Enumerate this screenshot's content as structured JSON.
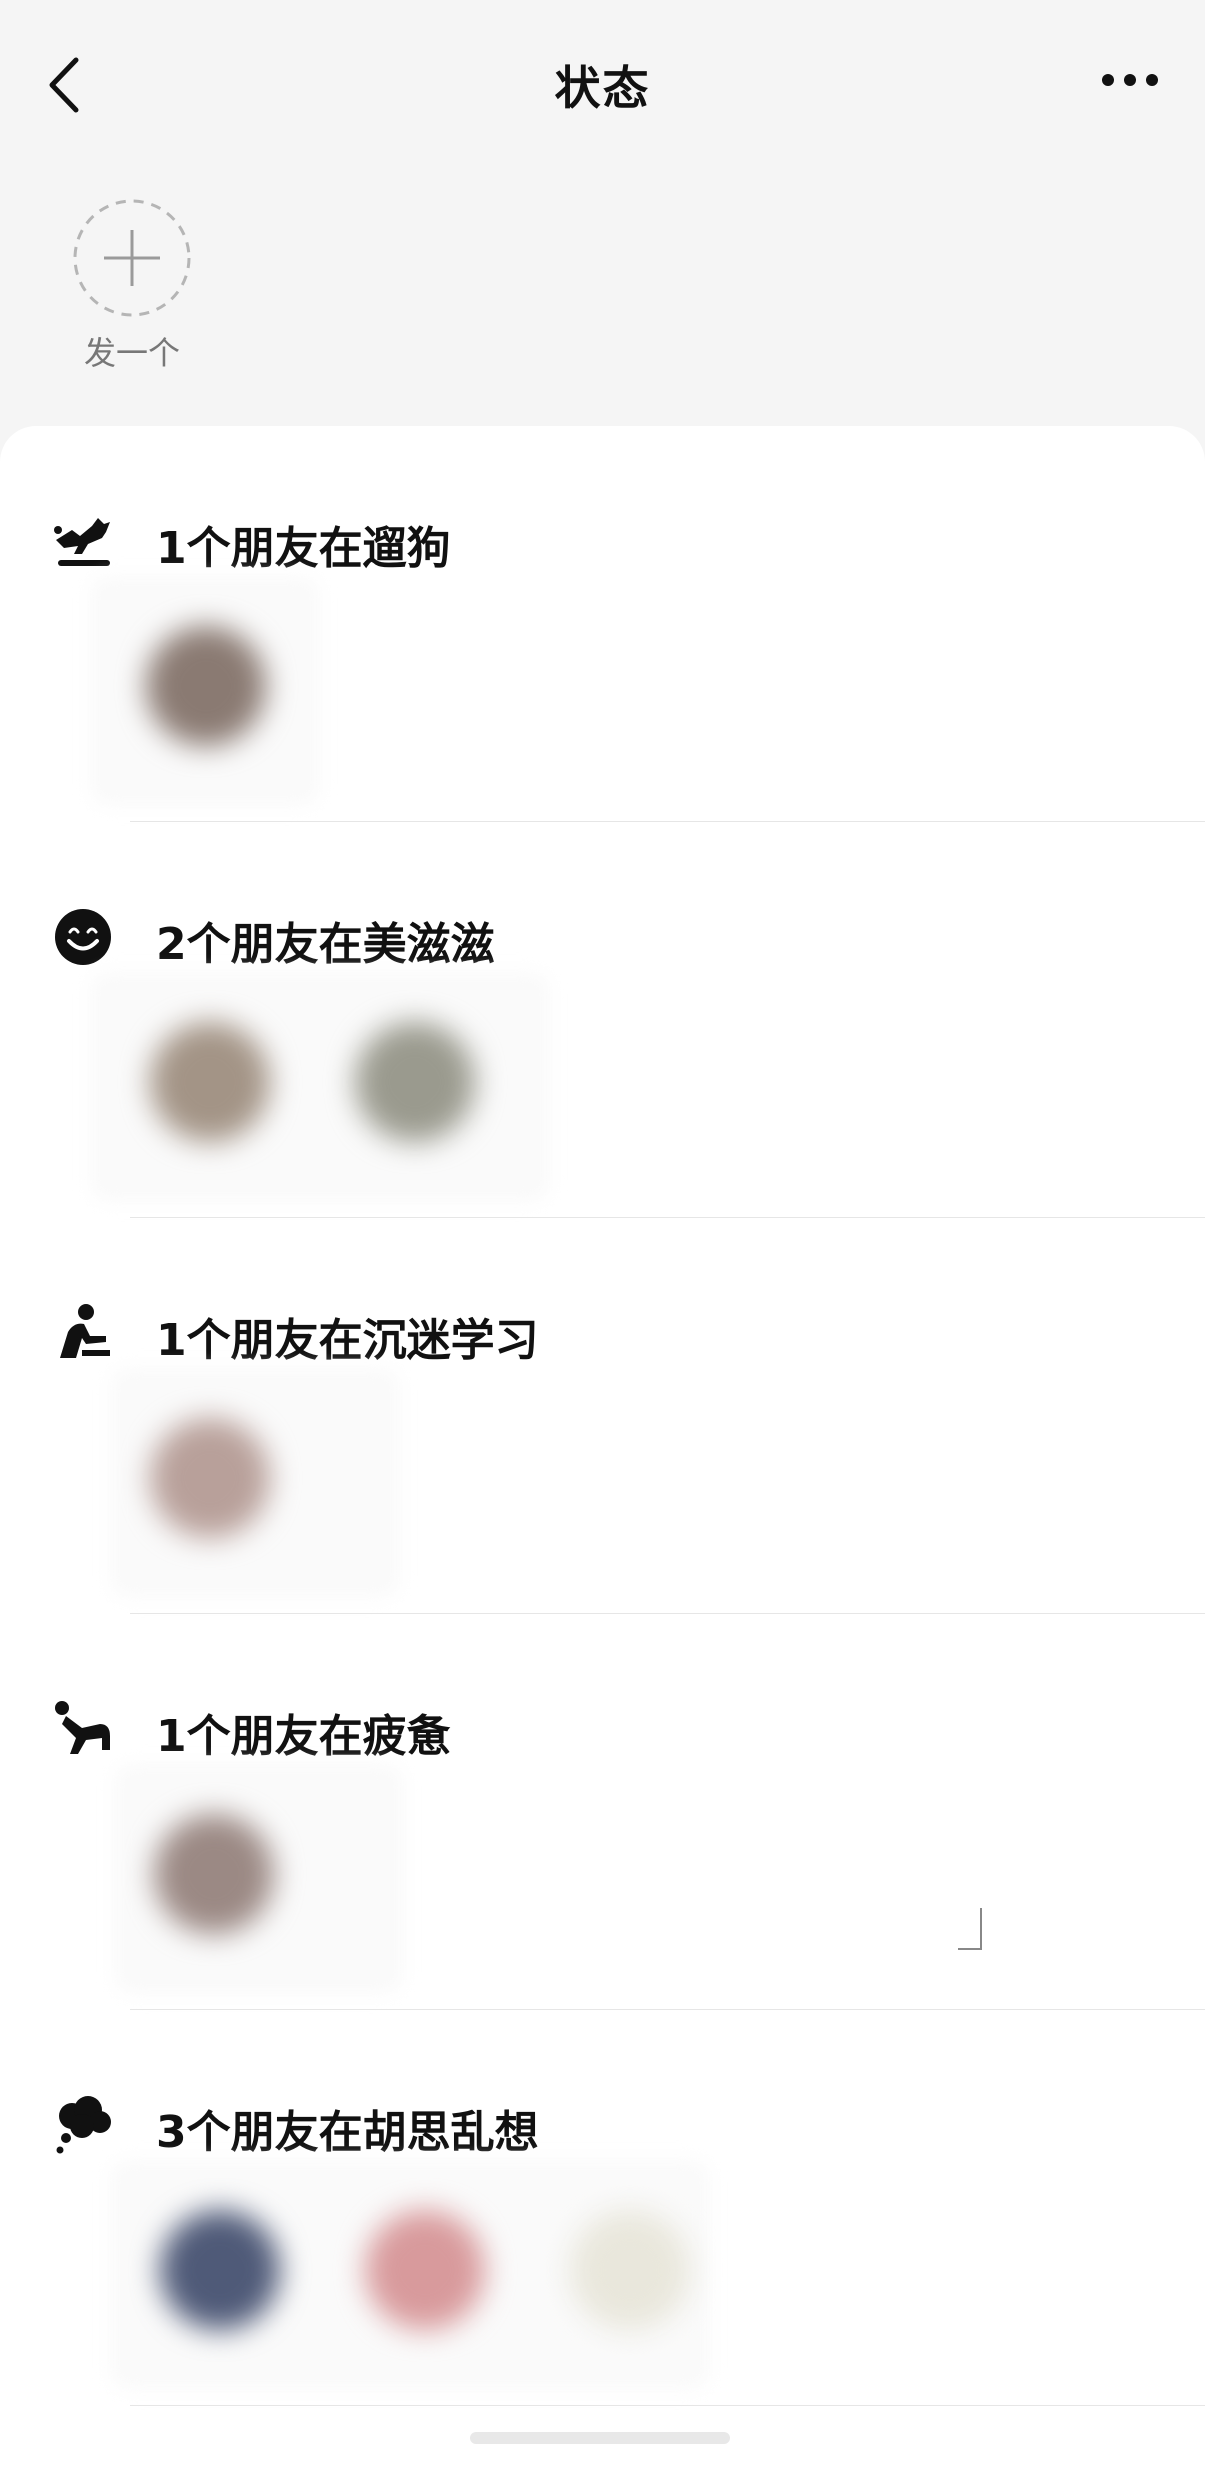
{
  "header": {
    "title": "状态",
    "back_icon": "chevron-left-icon",
    "more_icon": "more-dots-icon"
  },
  "compose": {
    "label": "发一个",
    "icon": "plus-icon"
  },
  "groups": [
    {
      "text": "1个朋友在遛狗",
      "icon": "dog-walking-icon",
      "avatar_count": 1,
      "avatar_colors": [
        "#8a7a72"
      ]
    },
    {
      "text": "2个朋友在美滋滋",
      "icon": "smile-icon",
      "avatar_count": 2,
      "avatar_colors": [
        "#a39486",
        "#9a9a8e"
      ]
    },
    {
      "text": "1个朋友在沉迷学习",
      "icon": "studying-icon",
      "avatar_count": 1,
      "avatar_colors": [
        "#b8a09a"
      ]
    },
    {
      "text": "1个朋友在疲惫",
      "icon": "tired-person-icon",
      "avatar_count": 1,
      "avatar_colors": [
        "#9b8984"
      ]
    },
    {
      "text": "3个朋友在胡思乱想",
      "icon": "thought-cloud-icon",
      "avatar_count": 3,
      "avatar_colors": [
        "#4f5a78",
        "#d89a9c",
        "#e9e7dc"
      ]
    }
  ],
  "colors": {
    "background": "#f5f5f5",
    "sheet": "#ffffff",
    "text_primary": "#111111",
    "text_secondary": "#777777",
    "divider": "#e6e6e6"
  }
}
